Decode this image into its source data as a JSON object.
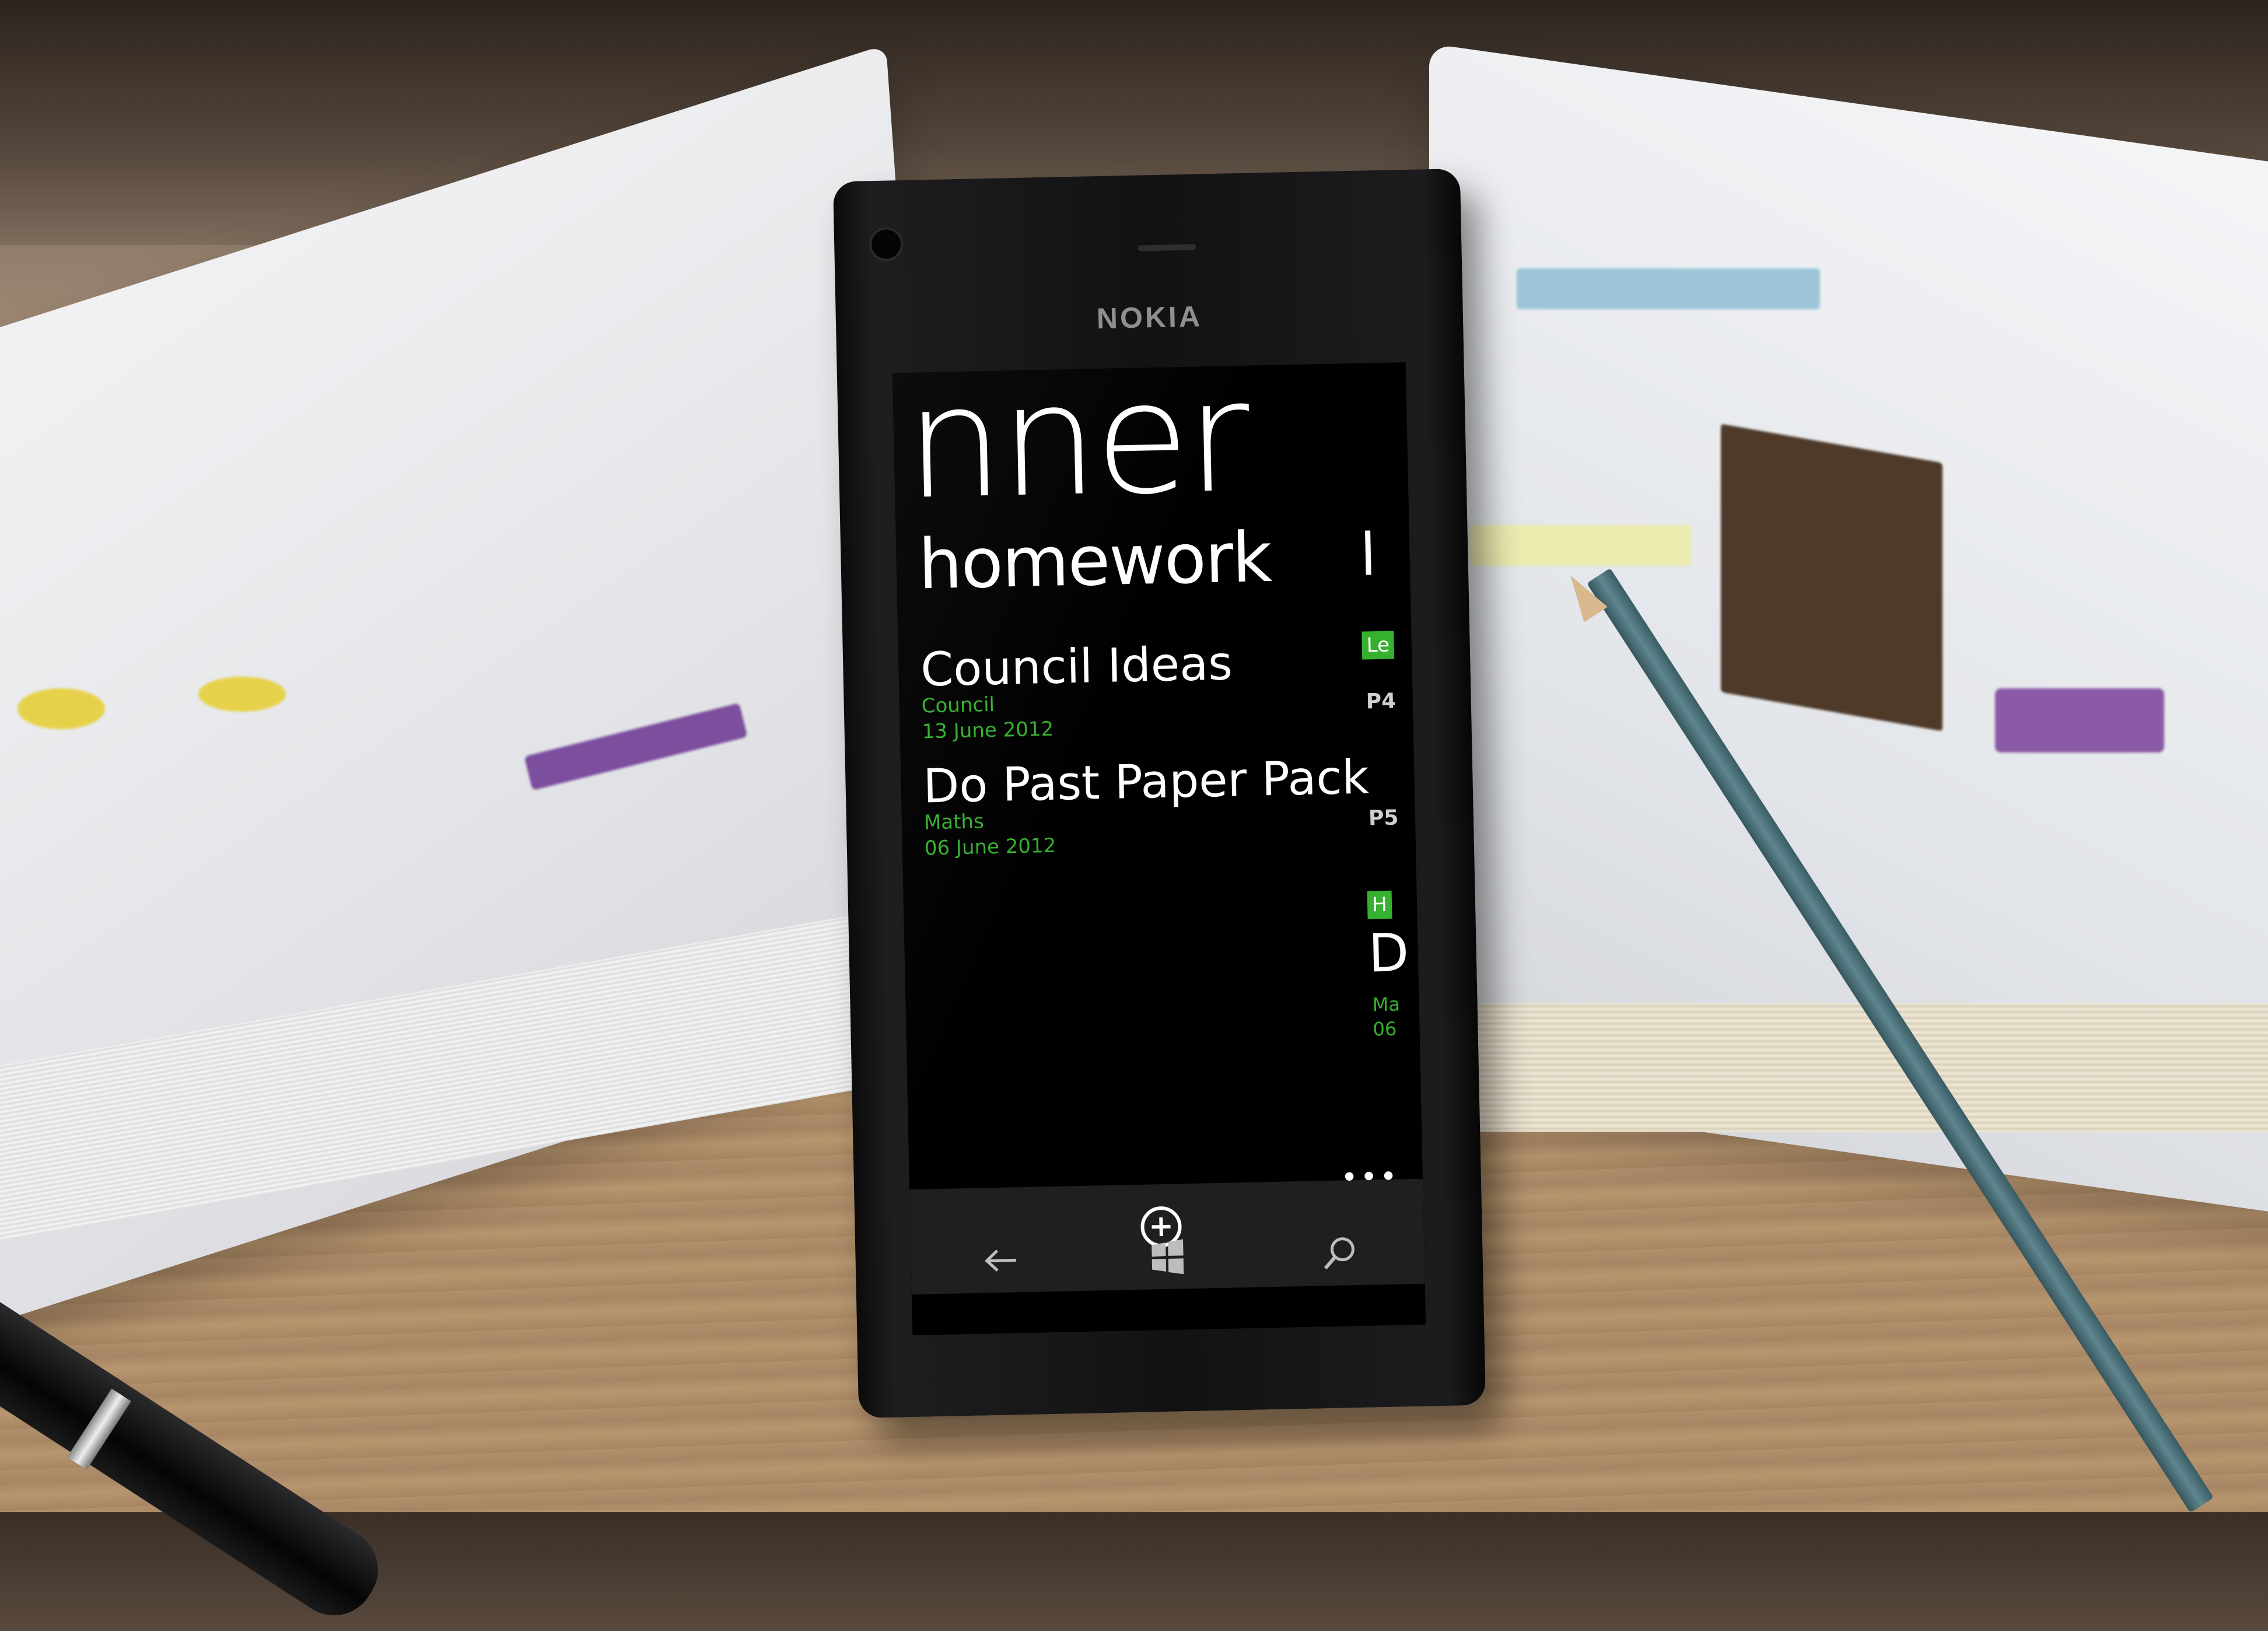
{
  "device": {
    "brand": "NOKIA"
  },
  "app": {
    "title": "nner"
  },
  "pivot": {
    "current_header": "homework",
    "items": [
      {
        "title": "Council Ideas",
        "subject": "Council",
        "date": "13 June 2012"
      },
      {
        "title": "Do Past Paper Pack",
        "subject": "Maths",
        "date": "06 June 2012"
      }
    ],
    "next_pane_peek": {
      "header": "l",
      "tag_1": "Le",
      "period_1": "P4",
      "period_2": "P5",
      "tag_2": "H",
      "item_initial": "D",
      "item_subject": "Ma",
      "item_date": "06"
    }
  },
  "app_bar": {
    "more_label": "•••",
    "add_icon": "add-circle-icon"
  },
  "hardware_keys": [
    "back-arrow-icon",
    "windows-logo-icon",
    "search-icon"
  ],
  "colors": {
    "accent": "#35b02f",
    "screen_bg": "#000000",
    "text": "#ffffff"
  }
}
